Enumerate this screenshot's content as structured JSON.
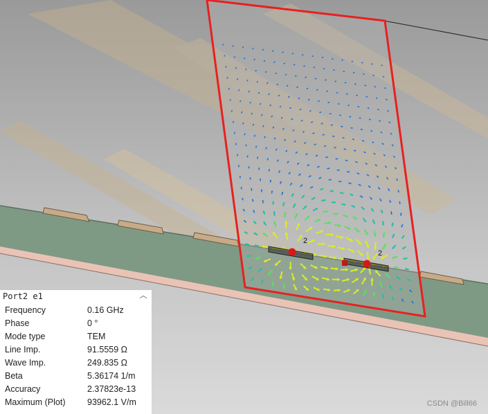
{
  "viewport": {
    "port_labels": [
      "2",
      "2"
    ],
    "colors": {
      "background_top": "#9a9a9a",
      "background_bottom": "#d8d8d8",
      "substrate_top": "#7f9a84",
      "substrate_edge": "#6f8a74",
      "ground": "#e9c3b6",
      "trace": "#c7ab88",
      "port_outline": "#e82020",
      "arrow_low": "#1e70d8",
      "arrow_mid": "#21c2a0",
      "arrow_high": "#58e060",
      "arrow_peak": "#d8ee20",
      "marker": "#d81818"
    }
  },
  "info_panel": {
    "title": "Port2 e1",
    "rows": [
      {
        "label": "Frequency",
        "value": "0.16 GHz"
      },
      {
        "label": "Phase",
        "value": "0 °"
      },
      {
        "label": "Mode type",
        "value": "TEM"
      },
      {
        "label": "Line Imp.",
        "value": "91.5559 Ω"
      },
      {
        "label": "Wave Imp.",
        "value": "249.835 Ω"
      },
      {
        "label": "Beta",
        "value": "5.36174 1/m"
      },
      {
        "label": "Accuracy",
        "value": "2.37823e-13"
      },
      {
        "label": "Maximum (Plot)",
        "value": "93962.1 V/m"
      }
    ]
  },
  "watermark": "CSDN @Bill66"
}
